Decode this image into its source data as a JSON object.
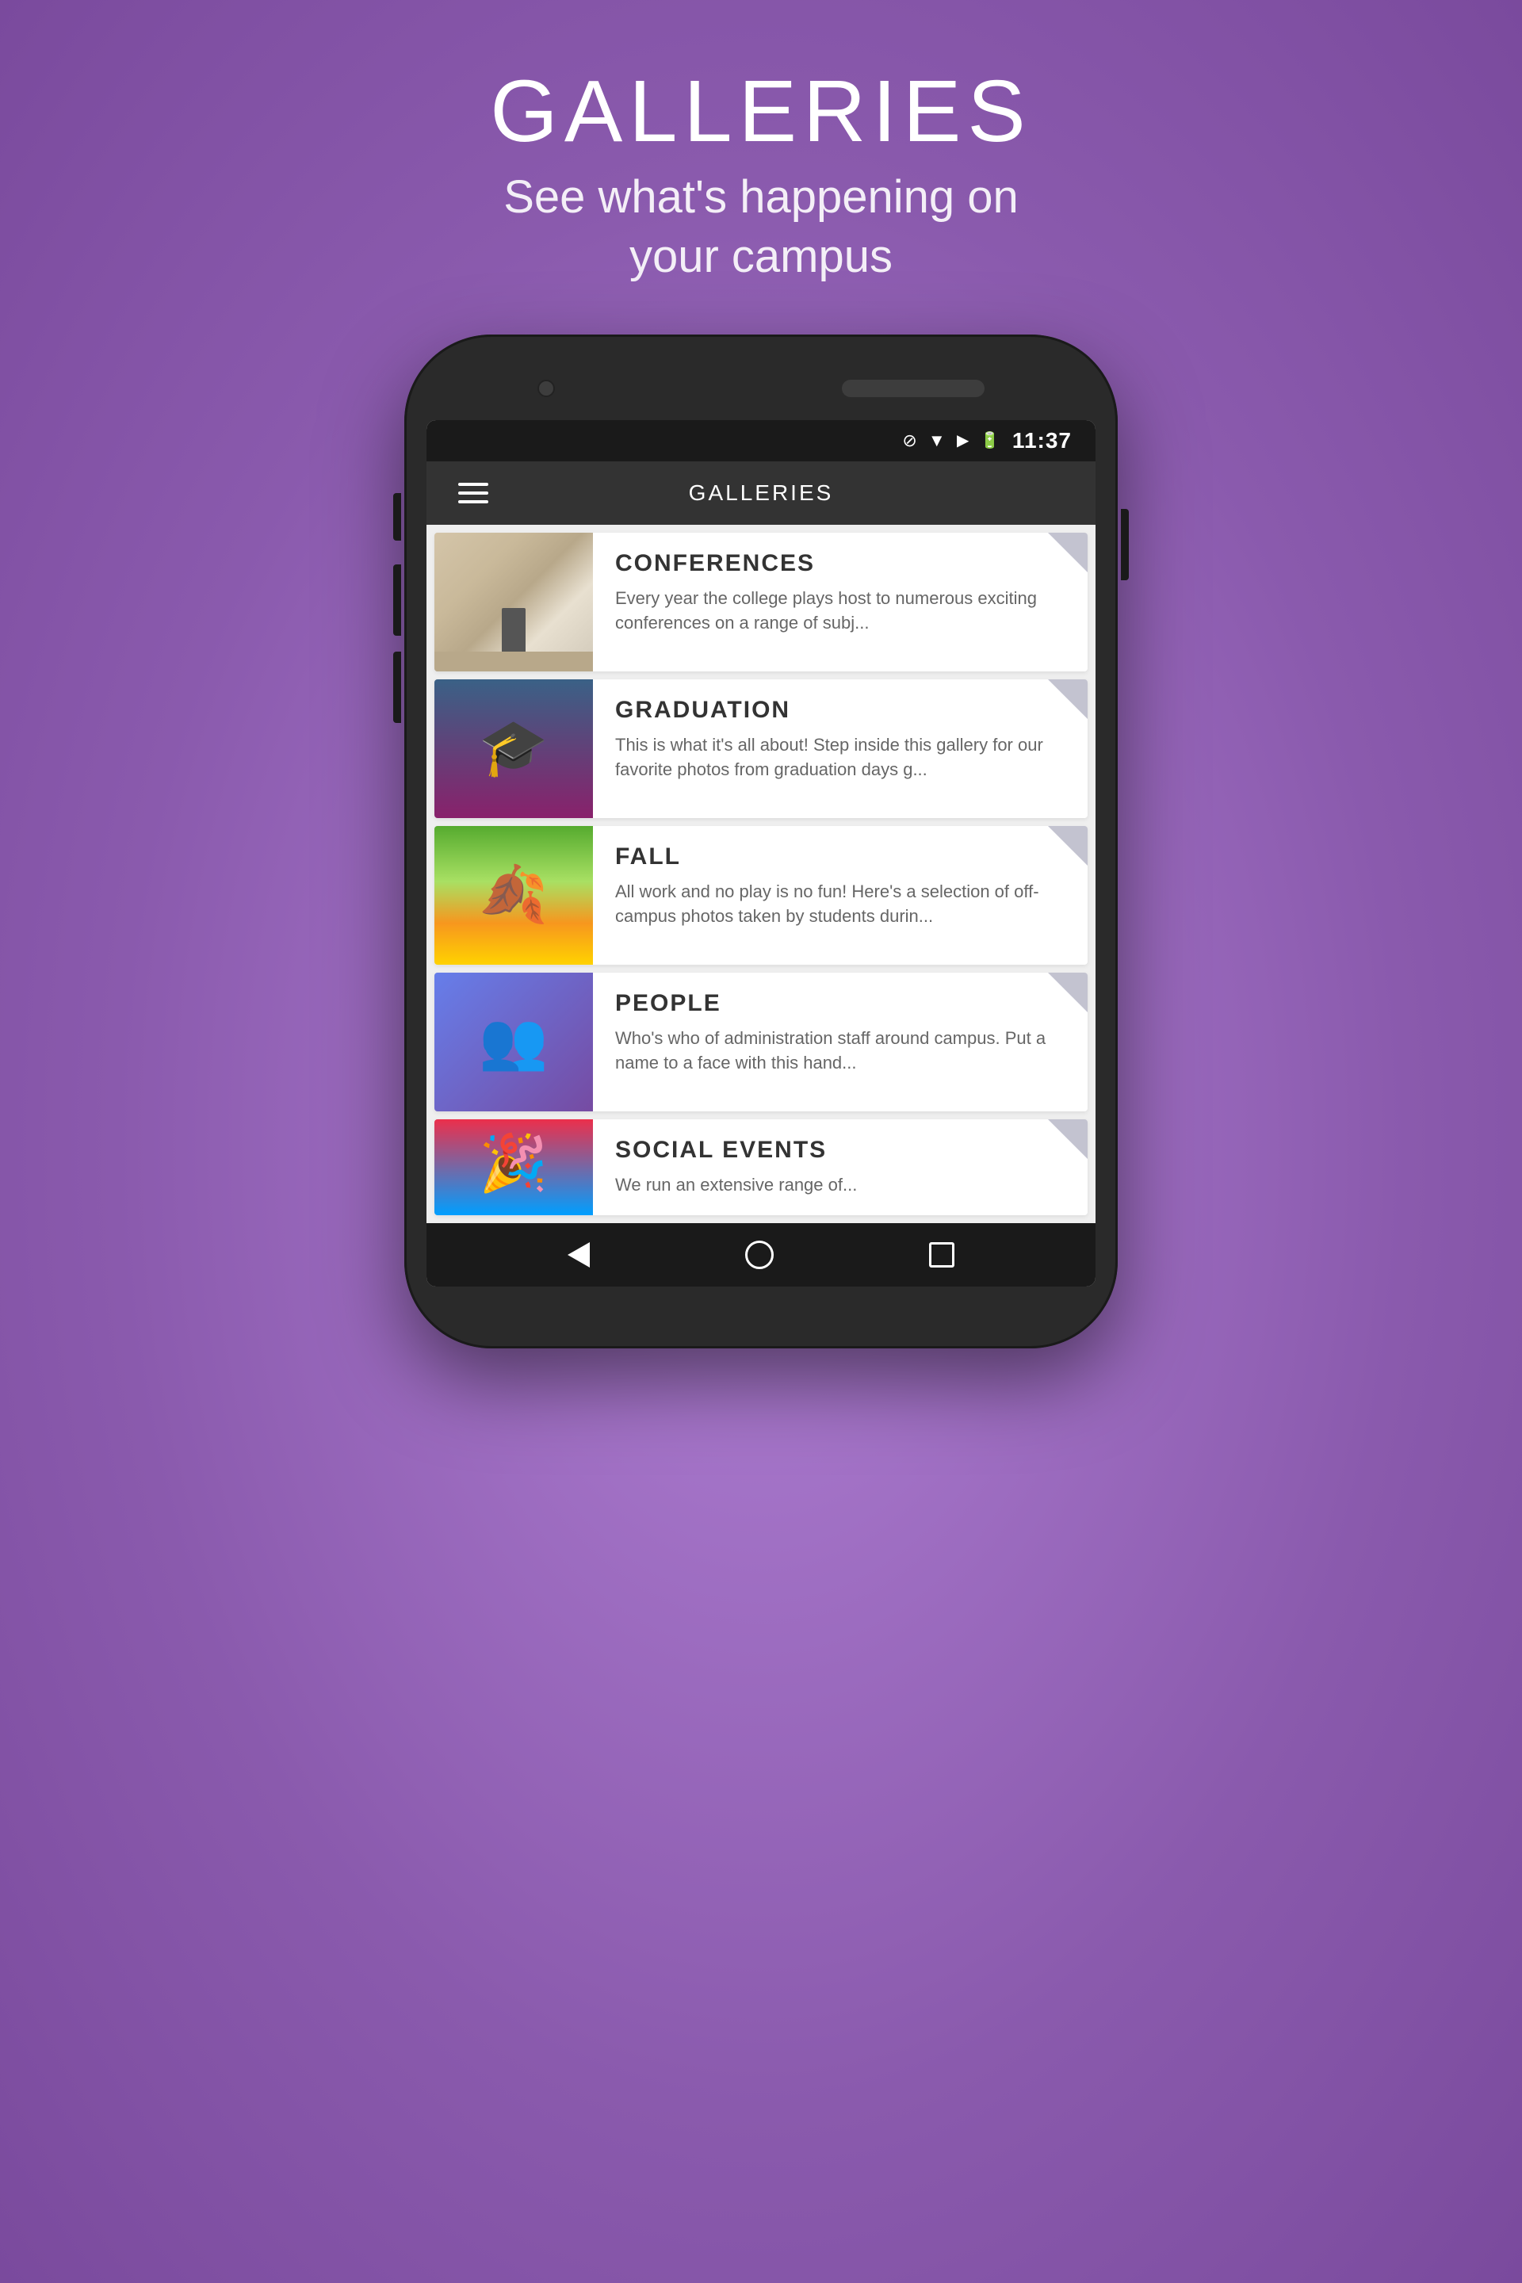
{
  "page": {
    "background_color": "#9b6fc0",
    "header": {
      "title": "GALLERIES",
      "subtitle": "See what's happening on\nyour campus"
    }
  },
  "status_bar": {
    "time": "11:37",
    "icons": [
      "blocked",
      "wifi",
      "signal",
      "battery"
    ]
  },
  "app_bar": {
    "menu_label": "≡",
    "title": "GALLERIES"
  },
  "gallery_items": [
    {
      "id": "conferences",
      "title": "CONFERENCES",
      "description": "Every year the college plays host to numerous exciting conferences on a range of subj..."
    },
    {
      "id": "graduation",
      "title": "GRADUATION",
      "description": "This is what it's all about!  Step inside this gallery for our favorite photos from graduation days g..."
    },
    {
      "id": "fall",
      "title": "FALL",
      "description": "All work and no play is no fun!  Here's a selection of off-campus photos taken by students durin..."
    },
    {
      "id": "people",
      "title": "PEOPLE",
      "description": "Who's who of administration staff around campus.  Put a name to a face with this hand..."
    },
    {
      "id": "social-events",
      "title": "SOCIAL EVENTS",
      "description": "We run an extensive range of..."
    }
  ],
  "nav": {
    "back_label": "back",
    "home_label": "home",
    "recents_label": "recents"
  }
}
